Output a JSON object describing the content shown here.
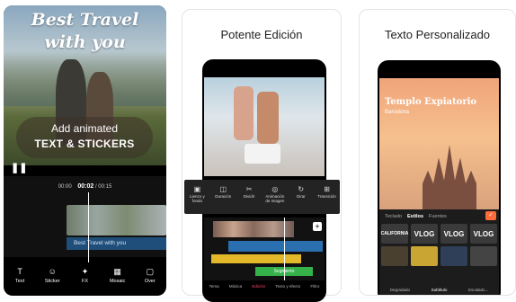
{
  "card1": {
    "title_line1": "Best Travel",
    "title_line2": "with you",
    "bubble_line1": "Add animated",
    "bubble_line2": "TEXT & STICKERS",
    "pause_icon": "pause-icon",
    "timecode_left": "00:00",
    "timecode_current": "00:02",
    "timecode_total": "/ 00:15",
    "text_clip": "Best Travel with you",
    "tools": [
      {
        "label": "Text",
        "icon": "T"
      },
      {
        "label": "Sticker",
        "icon": "☺"
      },
      {
        "label": "FX",
        "icon": "✦"
      },
      {
        "label": "Mosaic",
        "icon": "▦"
      },
      {
        "label": "Over",
        "icon": "▢"
      }
    ]
  },
  "card2": {
    "caption": "Potente Edición",
    "menu": [
      {
        "label": "Lienzo y fondo",
        "icon": "▣"
      },
      {
        "label": "Duración",
        "icon": "◫"
      },
      {
        "label": "Dividir",
        "icon": "✂"
      },
      {
        "label": "Animación de imagen",
        "icon": "◎"
      },
      {
        "label": "Girar",
        "icon": "↻"
      },
      {
        "label": "Transición",
        "icon": "⊞"
      }
    ],
    "green_clip": "Segmento",
    "nav": [
      "Tema",
      "Música",
      "Edición",
      "Texto y efecto",
      "Filtro"
    ],
    "nav_active": "Edición"
  },
  "card3": {
    "caption": "Texto Personalizado",
    "title": "Templo Expiatorio",
    "subtitle": "Barcelona",
    "tabs": [
      "Teclado",
      "Estilos",
      "Fuentes"
    ],
    "tab_active": "Estilos",
    "tiles": [
      "CALIFORNIA",
      "VLOG",
      "VLOG",
      "VLOG",
      "",
      "",
      "",
      ""
    ],
    "nav": [
      "Degradado",
      "Subtítulo",
      "Escalado..."
    ],
    "nav_active": "Subtítulo",
    "accent": "#ff6a3a"
  }
}
